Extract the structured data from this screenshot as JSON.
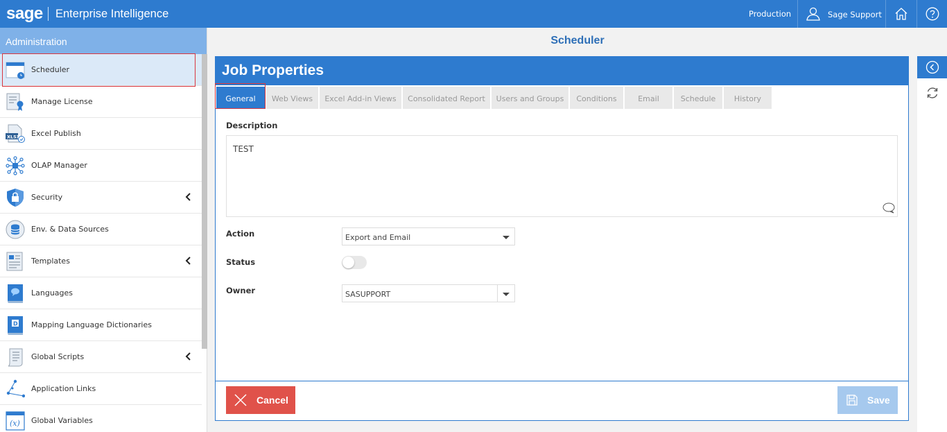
{
  "topbar": {
    "logo": "sage",
    "app_title": "Enterprise Intelligence",
    "environment": "Production",
    "user": "Sage Support",
    "icons": [
      "user-icon",
      "home-icon",
      "help-icon"
    ]
  },
  "sidebar": {
    "header": "Administration",
    "items": [
      {
        "label": "Scheduler",
        "icon": "calendar-icon",
        "expandable": false,
        "active": true
      },
      {
        "label": "Manage License",
        "icon": "license-icon",
        "expandable": false
      },
      {
        "label": "Excel Publish",
        "icon": "xlsx-icon",
        "expandable": false
      },
      {
        "label": "OLAP Manager",
        "icon": "olap-icon",
        "expandable": false
      },
      {
        "label": "Security",
        "icon": "shield-icon",
        "expandable": true
      },
      {
        "label": "Env. & Data Sources",
        "icon": "database-icon",
        "expandable": false
      },
      {
        "label": "Templates",
        "icon": "template-icon",
        "expandable": true
      },
      {
        "label": "Languages",
        "icon": "languages-icon",
        "expandable": false
      },
      {
        "label": "Mapping Language Dictionaries",
        "icon": "dictionary-icon",
        "expandable": false
      },
      {
        "label": "Global Scripts",
        "icon": "script-icon",
        "expandable": true
      },
      {
        "label": "Application Links",
        "icon": "links-icon",
        "expandable": false
      },
      {
        "label": "Global Variables",
        "icon": "variable-icon",
        "expandable": false
      }
    ]
  },
  "main": {
    "title": "Scheduler",
    "panel_title": "Job Properties",
    "tabs": [
      {
        "label": "General",
        "active": true
      },
      {
        "label": "Web Views"
      },
      {
        "label": "Excel Add-in Views"
      },
      {
        "label": "Consolidated Report"
      },
      {
        "label": "Users and Groups"
      },
      {
        "label": "Conditions"
      },
      {
        "label": "Email"
      },
      {
        "label": "Schedule"
      },
      {
        "label": "History"
      }
    ],
    "form": {
      "description_label": "Description",
      "description_value": "TEST",
      "action_label": "Action",
      "action_value": "Export and Email",
      "status_label": "Status",
      "status_on": false,
      "owner_label": "Owner",
      "owner_value": "SASUPPORT"
    },
    "buttons": {
      "cancel": "Cancel",
      "save": "Save"
    }
  },
  "colors": {
    "primary": "#2e7bcf",
    "sidebar_header": "#7fb1e8",
    "cancel": "#e0524a",
    "save_disabled": "#a6c9ee",
    "highlight": "#d9363e"
  }
}
